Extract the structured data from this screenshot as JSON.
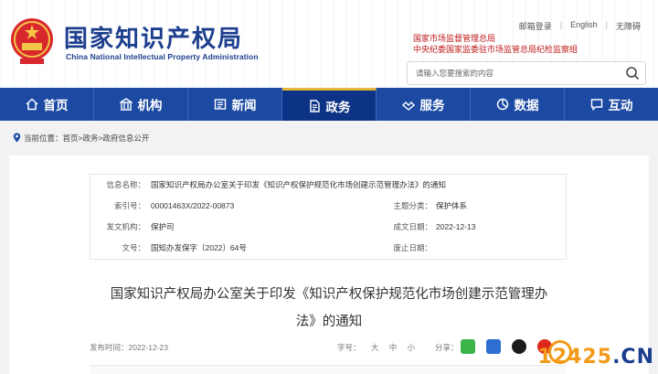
{
  "header": {
    "title": "国家知识产权局",
    "subtitle": "China National Intellectual Property Administration",
    "top_links": [
      "邮箱登录",
      "English",
      "无障碍"
    ],
    "samr_line1": "国家市场监督管理总局",
    "samr_line2": "中央纪委国家监委驻市场监管总局纪检监察组",
    "search_placeholder": "请输入您要搜索的内容"
  },
  "nav": {
    "items": [
      {
        "label": "首页",
        "icon": "home-icon"
      },
      {
        "label": "机构",
        "icon": "building-icon"
      },
      {
        "label": "新闻",
        "icon": "news-icon"
      },
      {
        "label": "政务",
        "icon": "document-icon",
        "active": true
      },
      {
        "label": "服务",
        "icon": "service-icon"
      },
      {
        "label": "数据",
        "icon": "data-icon"
      },
      {
        "label": "互动",
        "icon": "chat-icon"
      }
    ]
  },
  "breadcrumb": "当前位置：首页>政务>政府信息公开",
  "meta": {
    "info_name_label": "信息名称：",
    "info_name": "国家知识产权局办公室关于印发《知识产权保护规范化市场创建示范管理办法》的通知",
    "index_label": "索引号：",
    "index": "00001463X/2022-00873",
    "topic_label": "主题分类：",
    "topic": "保护体系",
    "issuer_label": "发文机构：",
    "issuer": "保护司",
    "date_label": "成文日期：",
    "date": "2022-12-13",
    "docno_label": "文号：",
    "docno": "国知办发保字〔2022〕64号",
    "expiry_label": "废止日期："
  },
  "doc": {
    "title_line1": "国家知识产权局办公室关于印发《知识产权保护规范化市场创建示范管理办",
    "title_line2": "法》的通知",
    "pubdate": "发布时间：2022-12-23",
    "font_size_label": "字号：",
    "font_large": "大",
    "font_medium": "中",
    "font_small": "小",
    "share_label": "分享："
  },
  "watermark": {
    "part1": "12425",
    "part2": ".CN"
  },
  "colors": {
    "nav": "#1c4aa3",
    "nav_active": "#0c3386",
    "logo": "#1d3f8e",
    "samr": "#c01a1a"
  }
}
